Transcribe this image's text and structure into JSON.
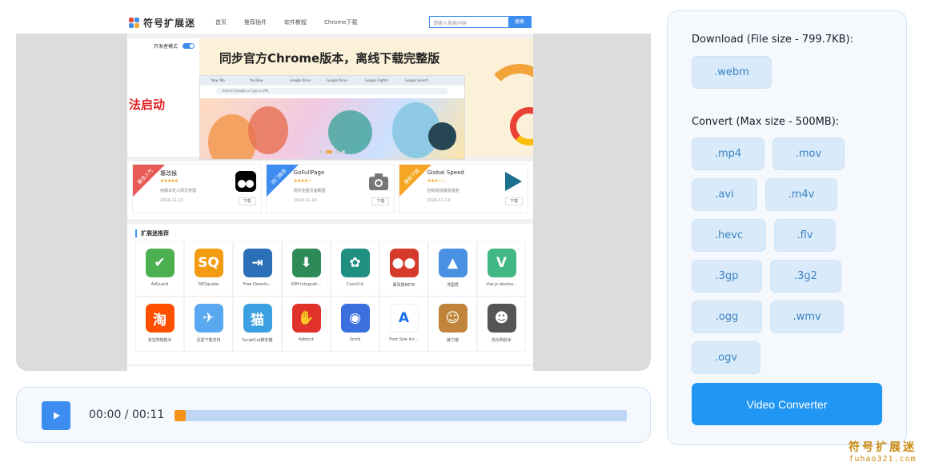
{
  "embedded_site": {
    "logo_text": "符号扩展迷",
    "nav": [
      "首页",
      "推荐插件",
      "软件教程",
      "Chrome下载"
    ],
    "search_placeholder": "请输入搜索内容",
    "search_button": "搜索",
    "toggle_label": "开发者模式",
    "banner_title": "同步官方Chrome版本，离线下载完整版",
    "banner_side_text": "法启动",
    "browser_tabs": [
      "New Tab",
      "YouTube",
      "Google Drive",
      "Google Drive",
      "Google Flights",
      "Google Search"
    ],
    "browser_address": "Search Google or type a URL",
    "featured": [
      {
        "ribbon": "最佳人气",
        "name": "篡改猴",
        "stars": "★★★★★",
        "desc": "用脚本定义网页管理",
        "date": "2024-11-15",
        "download": "下载",
        "ribbon_color": "#e85a55"
      },
      {
        "ribbon": "热门推荐",
        "name": "GoFullPage",
        "stars": "★★★★☆",
        "desc": "网页完整页面截图",
        "date": "2024-11-14",
        "download": "下载",
        "ribbon_color": "#3d8cf0"
      },
      {
        "ribbon": "最新下载",
        "name": "Global Speed",
        "stars": "★★★☆☆",
        "desc": "控制视频播放速度",
        "date": "2024-11-14",
        "download": "下载",
        "ribbon_color": "#f5a623"
      }
    ],
    "recommend_title": "扩展迷推荐",
    "apps": [
      {
        "name": "AdGuard",
        "icon": "adguard-icon",
        "color": "#4caf50",
        "glyph": "✔"
      },
      {
        "name": "SEOquake",
        "icon": "seoquake-icon",
        "color": "#f39c12",
        "glyph": "SQ"
      },
      {
        "name": "Free Downlo...",
        "icon": "free-download-icon",
        "color": "#2a6fb8",
        "glyph": "⇥"
      },
      {
        "name": "IDM Integrati...",
        "icon": "idm-icon",
        "color": "#2e8b57",
        "glyph": "⬇"
      },
      {
        "name": "CocoCut",
        "icon": "cococut-icon",
        "color": "#1f8f80",
        "glyph": "✿"
      },
      {
        "name": "篡改猴BETA",
        "icon": "tampermonkey-beta-icon",
        "color": "#d63a2a",
        "glyph": "●●"
      },
      {
        "name": "浮图秀",
        "icon": "image-viewer-icon",
        "color": "#4a90e2",
        "glyph": "▲"
      },
      {
        "name": "Vue.js devtoo...",
        "icon": "vue-devtools-icon",
        "color": "#41b883",
        "glyph": "V"
      },
      {
        "name": "淘宝购物助手",
        "icon": "taobao-icon",
        "color": "#ff5000",
        "glyph": "淘"
      },
      {
        "name": "迅雷下载支持",
        "icon": "xunlei-icon",
        "color": "#5aa9f0",
        "glyph": "✈"
      },
      {
        "name": "ScriptCat脚本猫",
        "icon": "scriptcat-icon",
        "color": "#3aa0e0",
        "glyph": "猫"
      },
      {
        "name": "Adblock",
        "icon": "adblock-icon",
        "color": "#e0312a",
        "glyph": "✋"
      },
      {
        "name": "Scrnli",
        "icon": "scrnli-icon",
        "color": "#3a6fdd",
        "glyph": "◉"
      },
      {
        "name": "Font Size Inc...",
        "icon": "font-size-icon",
        "color": "#ffffff",
        "glyph": "A"
      },
      {
        "name": "暴力猴",
        "icon": "violentmonkey-icon",
        "color": "#c0853a",
        "glyph": "☺"
      },
      {
        "name": "低价购助手",
        "icon": "robot-icon",
        "color": "#555555",
        "glyph": "☻"
      }
    ]
  },
  "player": {
    "time": "00:00 / 00:11",
    "progress_fraction": 0.025,
    "accent": "#3d8cf0",
    "progress_color": "#f59318"
  },
  "panel": {
    "download_heading": "Download (File size - 799.7KB):",
    "download_formats": [
      ".webm"
    ],
    "convert_heading": "Convert (Max size - 500MB):",
    "convert_formats": [
      ".mp4",
      ".mov",
      ".avi",
      ".m4v",
      ".hevc",
      ".flv",
      ".3gp",
      ".3g2",
      ".ogg",
      ".wmv",
      ".ogv"
    ],
    "convert_button": "Video Converter",
    "button_color": "#2196f3"
  },
  "watermark": {
    "line1": "符号扩展迷",
    "line2": "fuhao321.com"
  }
}
